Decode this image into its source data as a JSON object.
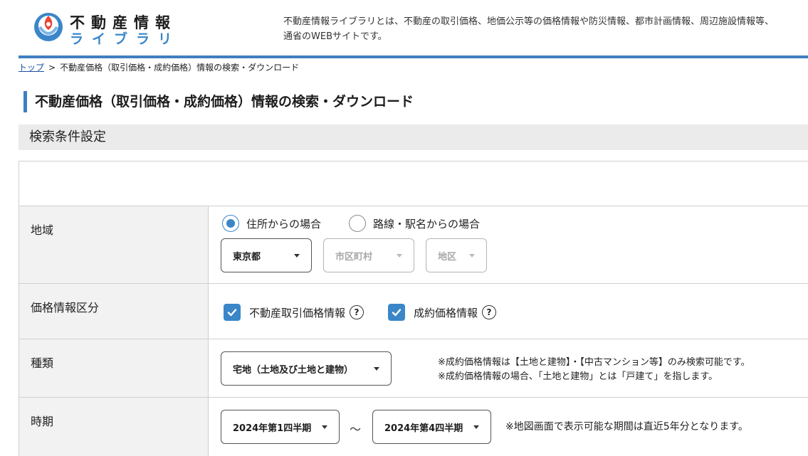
{
  "header": {
    "logo_top": "不動産情報",
    "logo_bottom": "ライブラリ",
    "description_line1": "不動産情報ライブラリとは、不動産の取引価格、地価公示等の価格情報や防災情報、都市計画情報、周辺施設情報等、",
    "description_line2": "通省のWEBサイトです。"
  },
  "breadcrumb": {
    "home": "トップ",
    "separator": ">",
    "current": "不動産価格（取引価格・成約価格）情報の検索・ダウンロード"
  },
  "page_title": "不動産価格（取引価格・成約価格）情報の検索・ダウンロード",
  "section_heading": "検索条件設定",
  "form": {
    "area": {
      "label": "地域",
      "radio_address": "住所からの場合",
      "radio_station": "路線・駅名からの場合",
      "prefecture": "東京都",
      "city": "市区町村",
      "district": "地区"
    },
    "price_category": {
      "label": "価格情報区分",
      "option_transaction": "不動産取引価格情報",
      "option_contract": "成約価格情報",
      "help_symbol": "?"
    },
    "type": {
      "label": "種類",
      "selected": "宅地（土地及び土地と建物）",
      "note1": "※成約価格情報は【土地と建物】・【中古マンション等】のみ検索可能です。",
      "note2": "※成約価格情報の場合、「土地と建物」とは「戸建て」を指します。"
    },
    "period": {
      "label": "時期",
      "from": "2024年第1四半期",
      "separator": "～",
      "to": "2024年第4四半期",
      "note": "※地図画面で表示可能な期間は直近5年分となります。"
    }
  },
  "colors": {
    "accent": "#3a86c8",
    "header_line": "#3f7fc1",
    "label_bg": "#f2f2f2",
    "section_bg": "#ebebeb"
  }
}
